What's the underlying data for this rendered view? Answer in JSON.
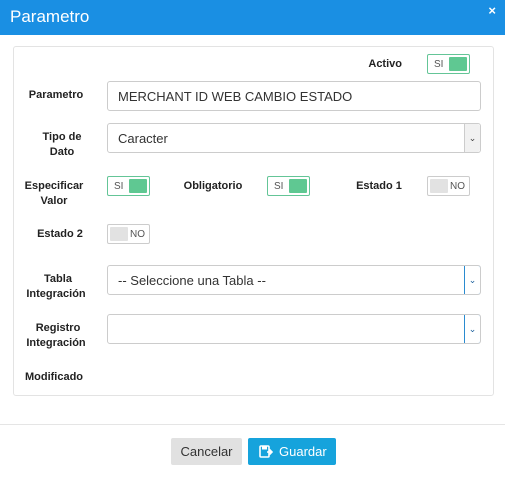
{
  "header": {
    "title": "Parametro",
    "close_icon": "×"
  },
  "form": {
    "activo": {
      "label": "Activo",
      "toggle_text": "SI",
      "state": "on"
    },
    "parametro": {
      "label": "Parametro",
      "value": "MERCHANT ID WEB CAMBIO ESTADO"
    },
    "tipo_dato": {
      "label_line1": "Tipo de",
      "label_line2": "Dato",
      "value": "Caracter"
    },
    "especificar_valor": {
      "label_line1": "Especificar",
      "label_line2": "Valor",
      "toggle_text": "SI",
      "state": "on"
    },
    "obligatorio": {
      "label": "Obligatorio",
      "toggle_text": "SI",
      "state": "on"
    },
    "estado1": {
      "label": "Estado 1",
      "toggle_text": "NO",
      "state": "off"
    },
    "estado2": {
      "label": "Estado 2",
      "toggle_text": "NO",
      "state": "off"
    },
    "tabla_integracion": {
      "label_line1": "Tabla",
      "label_line2": "Integración",
      "value": "-- Seleccione una Tabla --"
    },
    "registro_integracion": {
      "label_line1": "Registro",
      "label_line2": "Integración",
      "value": ""
    },
    "modificado": {
      "label": "Modificado"
    }
  },
  "footer": {
    "cancel_label": "Cancelar",
    "save_label": "Guardar"
  },
  "colors": {
    "header": "#1a8fe3",
    "toggle_on": "#5fc892",
    "save_button": "#16a3dc"
  }
}
